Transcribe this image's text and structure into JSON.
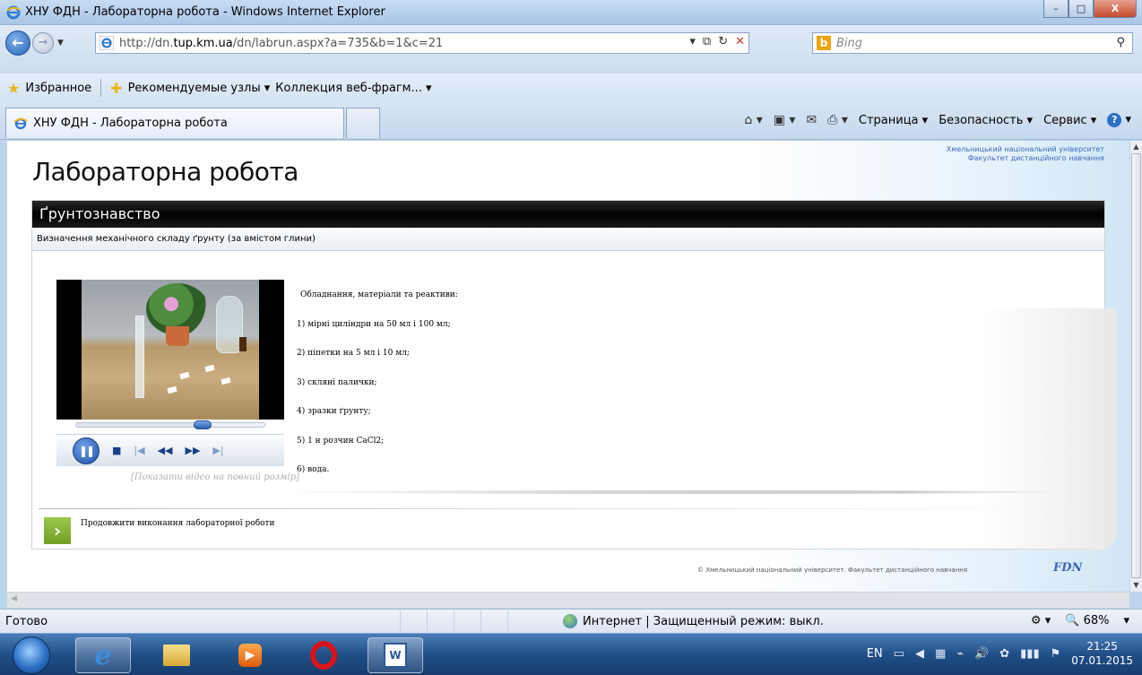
{
  "window": {
    "title": "ХНУ ФДН - Лабораторна робота - Windows Internet Explorer",
    "minimize": "–",
    "maximize": "□",
    "close": "X"
  },
  "address": {
    "url_prefix": "http://dn.",
    "url_domain": "tup.km.ua",
    "url_suffix": "/dn/labrun.aspx?a=735&b=1&c=21",
    "search_placeholder": "Bing"
  },
  "favorites": {
    "label": "Избранное",
    "items": [
      "Рекомендуемые узлы ▾",
      "Коллекция веб-фрагм... ▾"
    ]
  },
  "tabs": {
    "active_label": "ХНУ ФДН - Лабораторна робота"
  },
  "command_bar": {
    "page": "Страница ▾",
    "safety": "Безопасность ▾",
    "tools": "Сервис ▾"
  },
  "page": {
    "university_line1": "Хмельницький національний університет",
    "university_line2": "Факультет дистанційного навчання",
    "heading": "Лабораторна робота",
    "course": "Ґрунтознавство",
    "topic": "Визначення механічного складу ґрунту (за вмістом глини)",
    "video_fullsize_link": "[Показати відео на повний розмір]",
    "video_progress": 0.68,
    "materials_title": "Обладнання, матеріали та реактиви:",
    "materials": [
      "1) мірні циліндри на 50 мл і 100 мл;",
      "2) піпетки на 5 мл і 10 мл;",
      "3) скляні палички;",
      "4) зразки ґрунту;",
      "5) 1 н розчин CaCl2;",
      "6) вода."
    ],
    "continue_text": "Продовжити виконання лабораторної роботи",
    "copyright": "© Хмельницький національний університет. Факультет дистанційного навчання",
    "fdn_logo": "FDN"
  },
  "statusbar": {
    "status": "Готово",
    "zone": "Интернет | Защищенный режим: выкл.",
    "zoom": "68%"
  },
  "taskbar": {
    "lang": "EN",
    "time": "21:25",
    "date": "07.01.2015"
  }
}
